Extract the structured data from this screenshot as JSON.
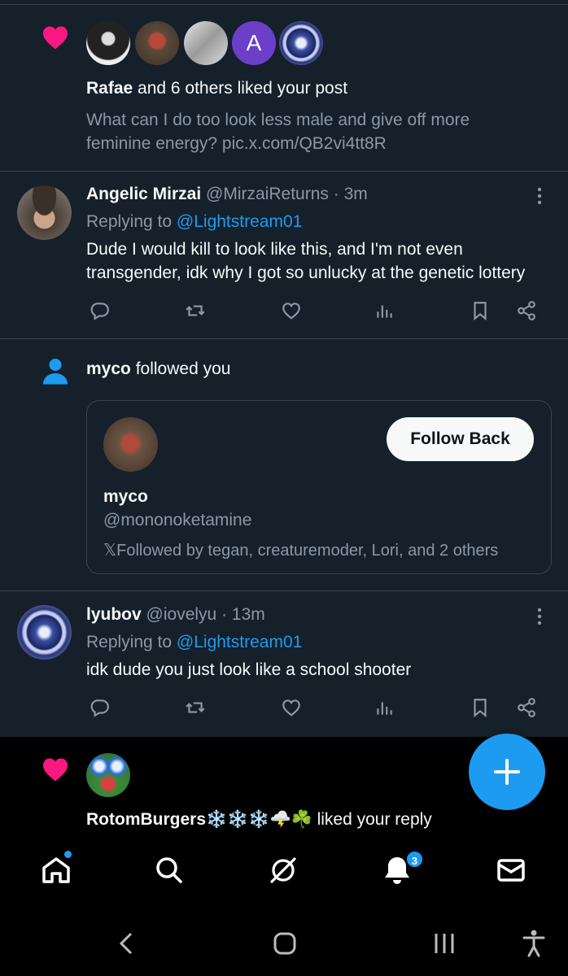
{
  "notif_like": {
    "liker": "Rafae",
    "suffix": " and 6 others liked your post",
    "post_line1": "What can I do too look less male and give off more",
    "post_line2": "feminine energy? pic.x.com/QB2vi4tt8R",
    "avatar_letter": "A"
  },
  "reply1": {
    "name": "Angelic Mirzai",
    "handle": "@MirzaiReturns",
    "time": "· 3m",
    "replying_prefix": "Replying to",
    "replying_to": "@Lightstream01",
    "text_line1": "Dude I would kill to look like this, and I'm not even",
    "text_line2": "transgender, idk why I got so unlucky at the genetic lottery"
  },
  "follow": {
    "name": "myco",
    "suffix": " followed you",
    "card_name": "myco",
    "card_handle": "@mononoketamine",
    "followed_by_prefix": "𝕏",
    "followed_by": "Followed by tegan, creaturemoder, Lori, and 2 others",
    "button": "Follow Back"
  },
  "reply2": {
    "name": "lyubov",
    "handle": "@iovelyu",
    "time": "· 13m",
    "replying_prefix": "Replying to",
    "replying_to": "@Lightstream01",
    "text_line1": "idk dude you just look like a school shooter"
  },
  "notif_like2": {
    "liker": "RotomBurgers❄️❄️❄️🌩️☘️",
    "suffix": " liked your reply"
  },
  "tabbar": {
    "notifications_badge": "3"
  },
  "colors": {
    "background": "#15202b",
    "accent": "#1d9bf0",
    "heart": "#f91880",
    "muted": "#8b98a5"
  }
}
